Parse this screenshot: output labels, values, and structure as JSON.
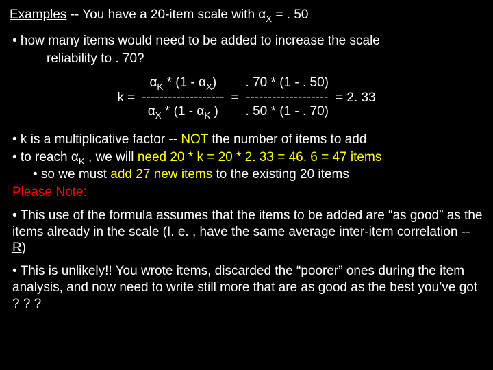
{
  "title_lead": "Examples",
  "title_rest": " --  You have a 20-item scale with ",
  "title_end": " = . 50",
  "alpha": "α",
  "q_line1": "• how many items would need to be added to increase the scale",
  "q_line2": "reliability to . 70?",
  "f_keq": "k  =",
  "f_top1_a": " * (1 - ",
  "f_top1_b": ")",
  "f_dash": "-------------------",
  "f_bot1_a": " * (1 - ",
  "f_bot1_b": " )",
  "f_eq": "=",
  "f_top2": ". 70 * (1 - . 50)",
  "f_bot2": ". 50 * (1 - . 70)",
  "f_res": "= 2. 33",
  "p1_a": "• k is a multiplicative factor -- ",
  "p1_b": "NOT",
  "p1_c": " the number of items to add",
  "p2_a": "• to reach ",
  "p2_b": " , we will ",
  "p2_c": "need 20 * k = 20 * 2. 33 = 46. 6 = 47 items",
  "p3_a": "• so we must ",
  "p3_b": "add 27 new items",
  "p3_c": " to the existing 20 items",
  "note": "Please Note:",
  "para1": "• This use of the formula assumes that the items to be added are “as good” as the items already in the scale (I. e. , have the same average inter-item correlation -- ",
  "para1_r": "R",
  "para1_end": ")",
  "para2": "• This is unlikely!!  You wrote items, discarded the “poorer” ones during the item analysis, and now need to write still more that are as good as the best you’ve got ? ? ?"
}
